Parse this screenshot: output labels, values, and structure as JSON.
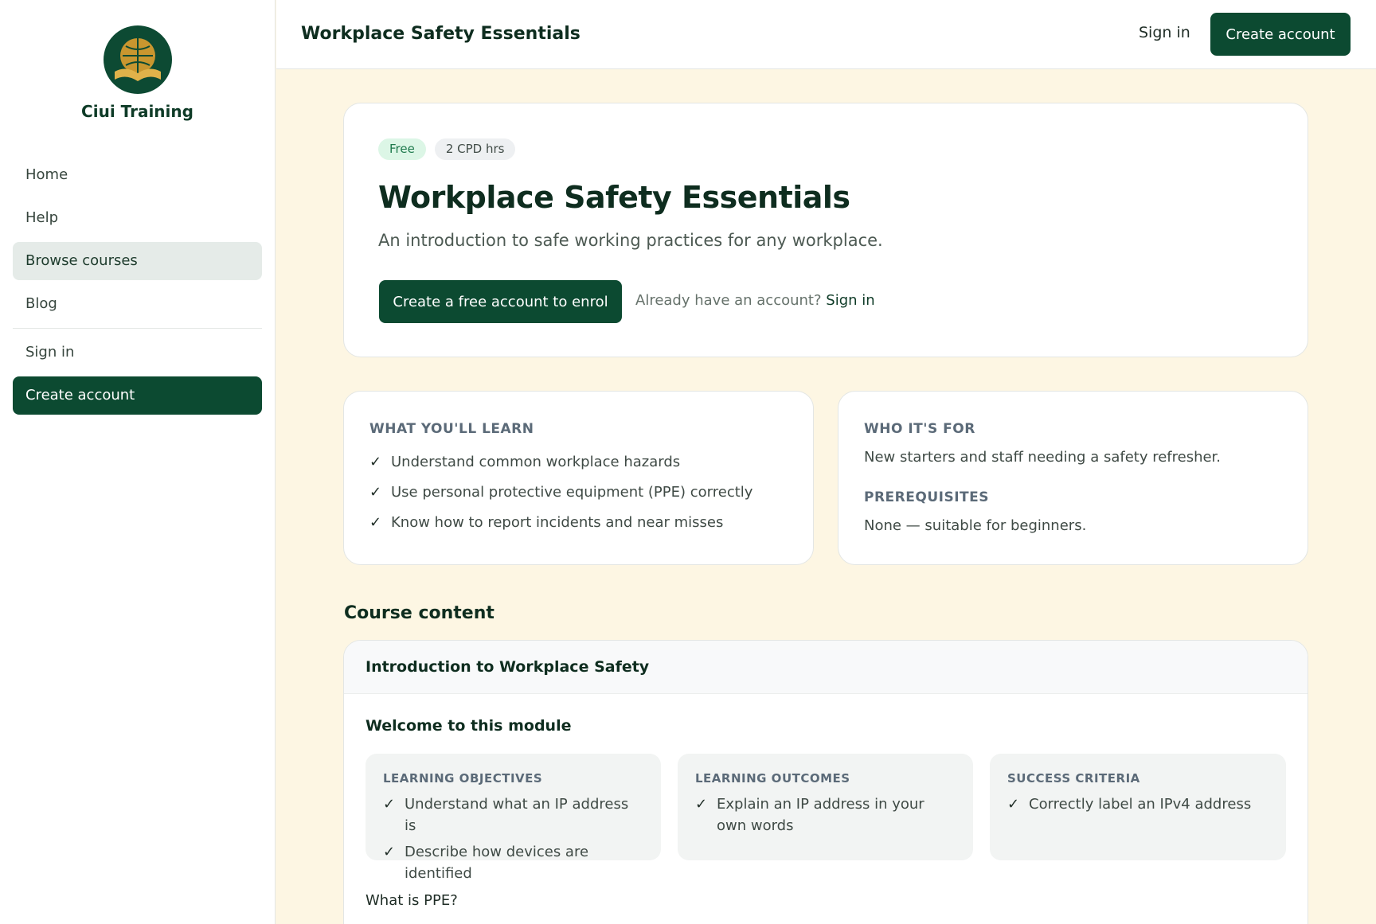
{
  "brand": {
    "name": "Ciui Training",
    "logo_icon": "globe-book-logo"
  },
  "sidebar": {
    "items": [
      {
        "label": "Home"
      },
      {
        "label": "Help"
      },
      {
        "label": "Browse courses"
      },
      {
        "label": "Blog"
      },
      {
        "label": "Sign in"
      },
      {
        "label": "Create account"
      }
    ]
  },
  "header": {
    "title": "Workplace Safety Essentials",
    "signin": "Sign in",
    "create": "Create account"
  },
  "hero": {
    "badge_free": "Free",
    "badge_cpd": "2 CPD hrs",
    "title": "Workplace Safety Essentials",
    "subtitle": "An introduction to safe working practices for any workplace.",
    "cta": "Create a free account to enrol",
    "already": "Already have an account?",
    "signin": "Sign in"
  },
  "learn": {
    "label": "WHAT YOU'LL LEARN",
    "items": [
      "Understand common workplace hazards",
      "Use personal protective equipment (PPE) correctly",
      "Know how to report incidents and near misses"
    ]
  },
  "who": {
    "label": "WHO IT'S FOR",
    "text": "New starters and staff needing a safety refresher.",
    "prereq_label": "PREREQUISITES",
    "prereq_text": "None — suitable for beginners."
  },
  "content": {
    "heading": "Course content",
    "module_title": "Introduction to Workplace Safety",
    "welcome": "Welcome to this module",
    "objectives": {
      "label": "LEARNING OBJECTIVES",
      "items": [
        "Understand what an IP address is",
        "Describe how devices are identified"
      ]
    },
    "outcomes": {
      "label": "LEARNING OUTCOMES",
      "items": [
        "Explain an IP address in your own words"
      ]
    },
    "criteria": {
      "label": "SUCCESS CRITERIA",
      "items": [
        "Correctly label an IPv4 address"
      ]
    },
    "ppe": "What is PPE?"
  },
  "tick": "✓",
  "colors": {
    "primary": "#0c4a31",
    "background": "#fdf6e3",
    "badge_free_bg": "#dcf6e6"
  }
}
